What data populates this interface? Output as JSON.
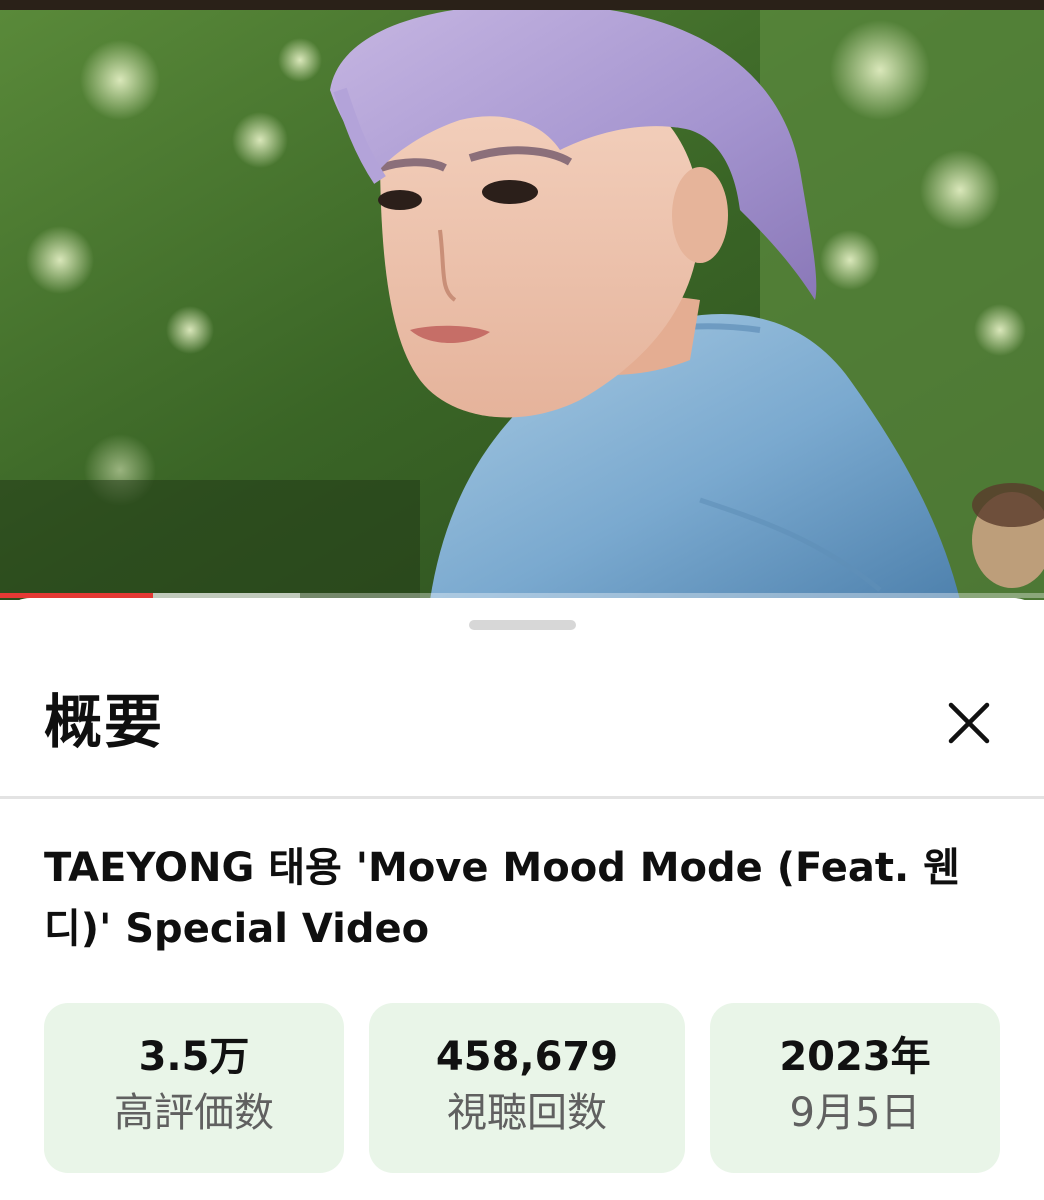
{
  "video": {
    "thumbnail": "young man with lavender hair and denim jacket looking over his shoulder, green trees background",
    "progress": 0.147,
    "buffered": 0.287,
    "progress_color": "#e53935"
  },
  "sheet": {
    "title": "概要",
    "close_icon": "close-icon"
  },
  "video_info": {
    "title": "TAEYONG 태용 'Move Mood Mode (Feat. 웬디)' Special Video"
  },
  "stats": [
    {
      "value": "3.5万",
      "label": "高評価数"
    },
    {
      "value": "458,679",
      "label": "視聴回数"
    },
    {
      "value": "2023年",
      "label": "9月5日"
    }
  ],
  "colors": {
    "stat_bg": "#e9f5e8",
    "accent": "#e53935"
  }
}
